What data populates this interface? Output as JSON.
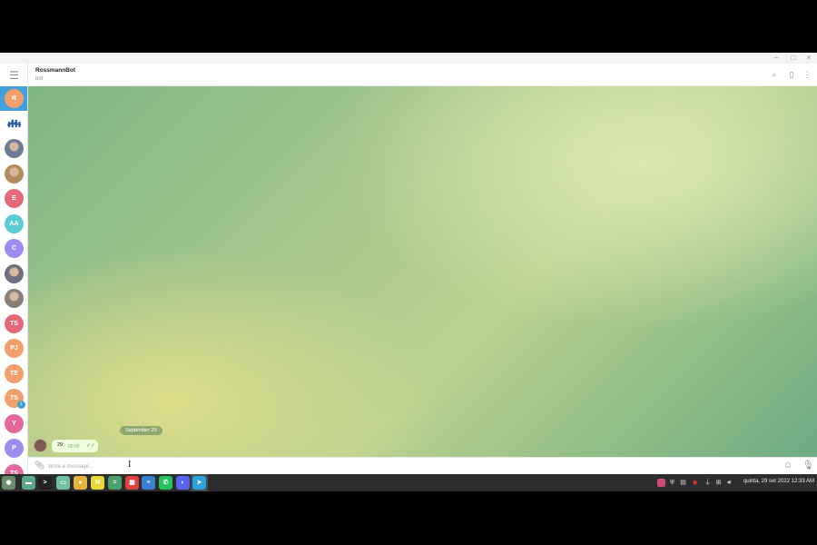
{
  "window": {
    "minimize_glyph": "–",
    "maximize_glyph": "□",
    "close_glyph": "×"
  },
  "sidebar": {
    "menu_icon": "menu-icon",
    "chats": [
      {
        "initials": "R",
        "color": "#f2a06b",
        "selected": true
      },
      {
        "initials": "",
        "color": "#ffffff",
        "icon": "group-people-icon"
      },
      {
        "initials": "",
        "color": "#6c7d93",
        "icon": "photo-avatar"
      },
      {
        "initials": "",
        "color": "#b58a5e",
        "icon": "photo-avatar"
      },
      {
        "initials": "E",
        "color": "#e5687a"
      },
      {
        "initials": "AA",
        "color": "#5ccbd4"
      },
      {
        "initials": "C",
        "color": "#9d8cf0"
      },
      {
        "initials": "",
        "color": "#6f6f7f",
        "icon": "photo-avatar"
      },
      {
        "initials": "",
        "color": "#8a7f78",
        "icon": "photo-avatar"
      },
      {
        "initials": "TS",
        "color": "#e5687a"
      },
      {
        "initials": "PJ",
        "color": "#f2a06b"
      },
      {
        "initials": "TE",
        "color": "#f2a06b"
      },
      {
        "initials": "TS",
        "color": "#f2a06b",
        "badge": "1"
      },
      {
        "initials": "Y",
        "color": "#e5689a"
      },
      {
        "initials": "P",
        "color": "#9d8cf0"
      },
      {
        "initials": "TS",
        "color": "#e5689a"
      }
    ]
  },
  "header": {
    "title": "RossmannBot",
    "subtitle": "bot",
    "icons": [
      "search-icon",
      "sidebar-toggle-icon",
      "more-vertical-icon"
    ]
  },
  "chat": {
    "date_label": "September 29",
    "messages": [
      {
        "text": "29",
        "time": "00:00",
        "status": "read"
      }
    ]
  },
  "composer": {
    "placeholder": "Write a message...",
    "value": "",
    "icons": [
      "attach-icon",
      "emoji-icon",
      "microphone-icon"
    ]
  },
  "taskbar": {
    "apps": [
      {
        "name": "start-menu",
        "color": "#6a8d6a",
        "glyph": "◉"
      },
      {
        "name": "files",
        "color": "#5aa88a",
        "glyph": "▬"
      },
      {
        "name": "terminal",
        "color": "#222222",
        "glyph": ">"
      },
      {
        "name": "folder",
        "color": "#6fbfa0",
        "glyph": "▭"
      },
      {
        "name": "chrome",
        "color": "#e8b33a",
        "glyph": "●"
      },
      {
        "name": "notes",
        "color": "#e8d93a",
        "glyph": "N"
      },
      {
        "name": "calculator",
        "color": "#4aa06a",
        "glyph": "="
      },
      {
        "name": "calendar",
        "color": "#e04040",
        "glyph": "▦"
      },
      {
        "name": "editor",
        "color": "#3a7fd0",
        "glyph": "≡"
      },
      {
        "name": "whatsapp",
        "color": "#28c15e",
        "glyph": "✆"
      },
      {
        "name": "discord",
        "color": "#5865f2",
        "glyph": "◐"
      },
      {
        "name": "telegram",
        "color": "#2aa3dd",
        "glyph": "➤",
        "active": true
      }
    ],
    "tray_icons": [
      "color-picker-icon",
      "shield-icon",
      "clipboard-icon",
      "record-icon",
      "usb-icon",
      "network-icon",
      "volume-icon"
    ],
    "clock": "quinta, 29 set 2022 12:33 AM"
  }
}
